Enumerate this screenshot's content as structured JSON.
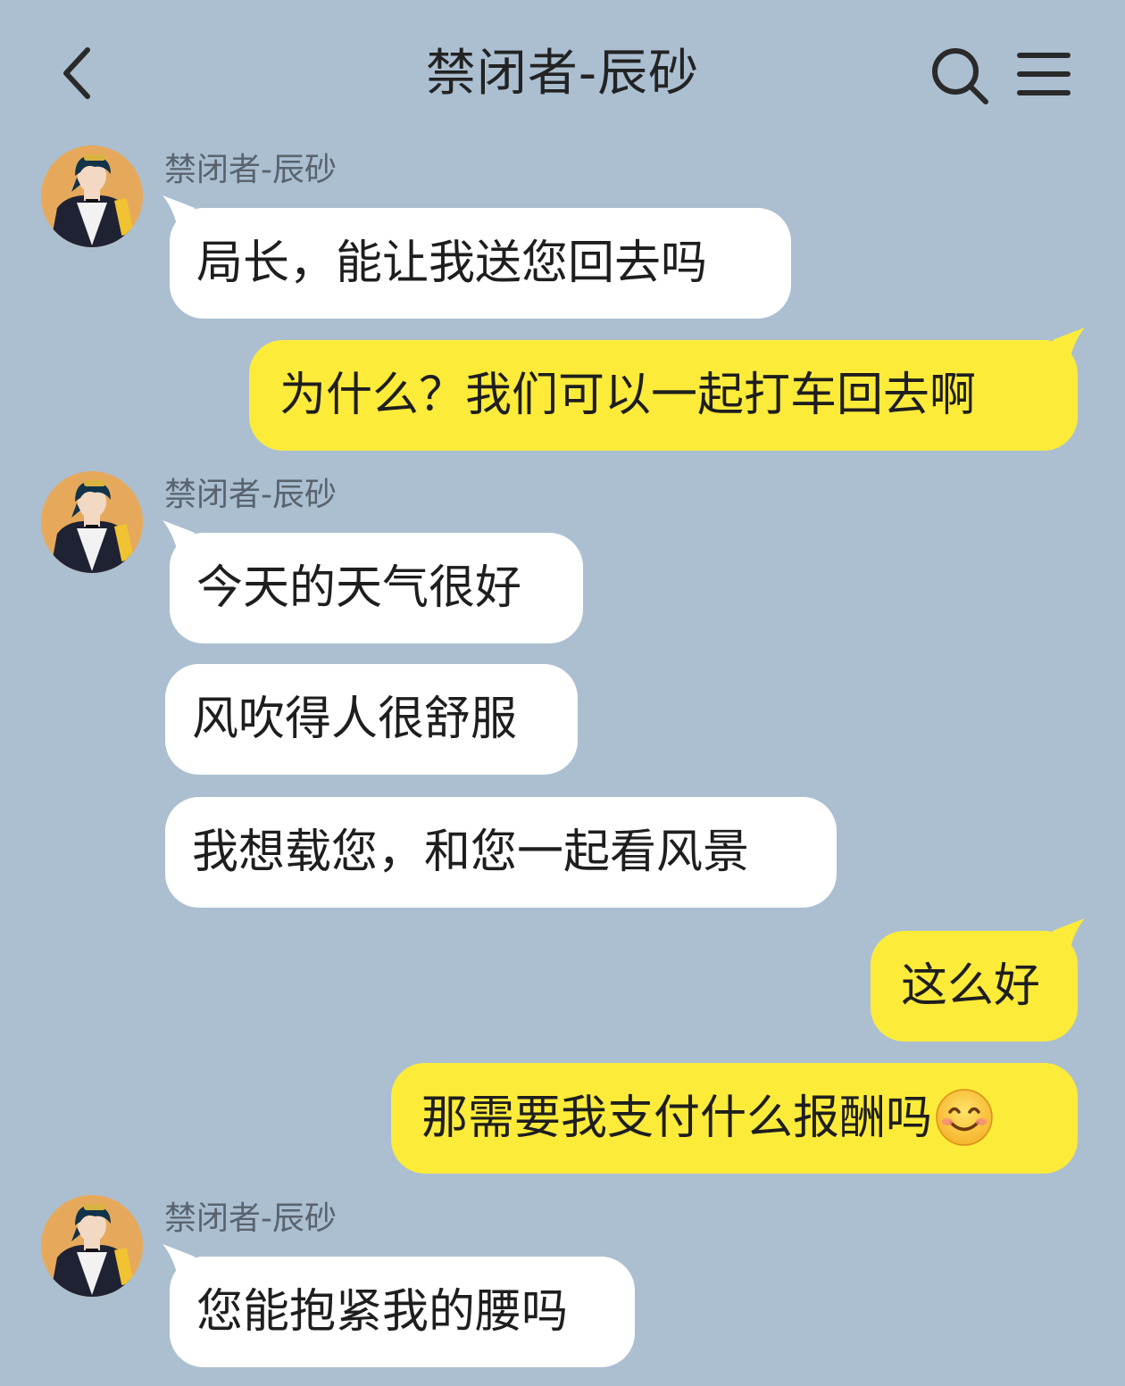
{
  "header": {
    "title": "禁闭者-辰砂",
    "back_icon": "chevron-left-icon",
    "search_icon": "search-icon",
    "menu_icon": "menu-icon"
  },
  "contact": {
    "name": "禁闭者-辰砂",
    "avatar_icon": "avatar-image"
  },
  "messages": [
    {
      "from": "contact",
      "text": "局长，能让我送您回去吗"
    },
    {
      "from": "me",
      "text": "为什么？我们可以一起打车回去啊"
    },
    {
      "from": "contact",
      "text": "今天的天气很好"
    },
    {
      "from": "contact",
      "text": "风吹得人很舒服"
    },
    {
      "from": "contact",
      "text": "我想载您，和您一起看风景"
    },
    {
      "from": "me",
      "text": "这么好"
    },
    {
      "from": "me",
      "text": "那需要我支付什么报酬吗",
      "emoji": "smiling-face-emoji"
    },
    {
      "from": "contact",
      "text": "您能抱紧我的腰吗"
    }
  ],
  "colors": {
    "background": "#abbfd1",
    "incoming_bubble": "#ffffff",
    "outgoing_bubble": "#fdeb3a",
    "sender_name": "#59636e",
    "text": "#1e1e1e"
  }
}
